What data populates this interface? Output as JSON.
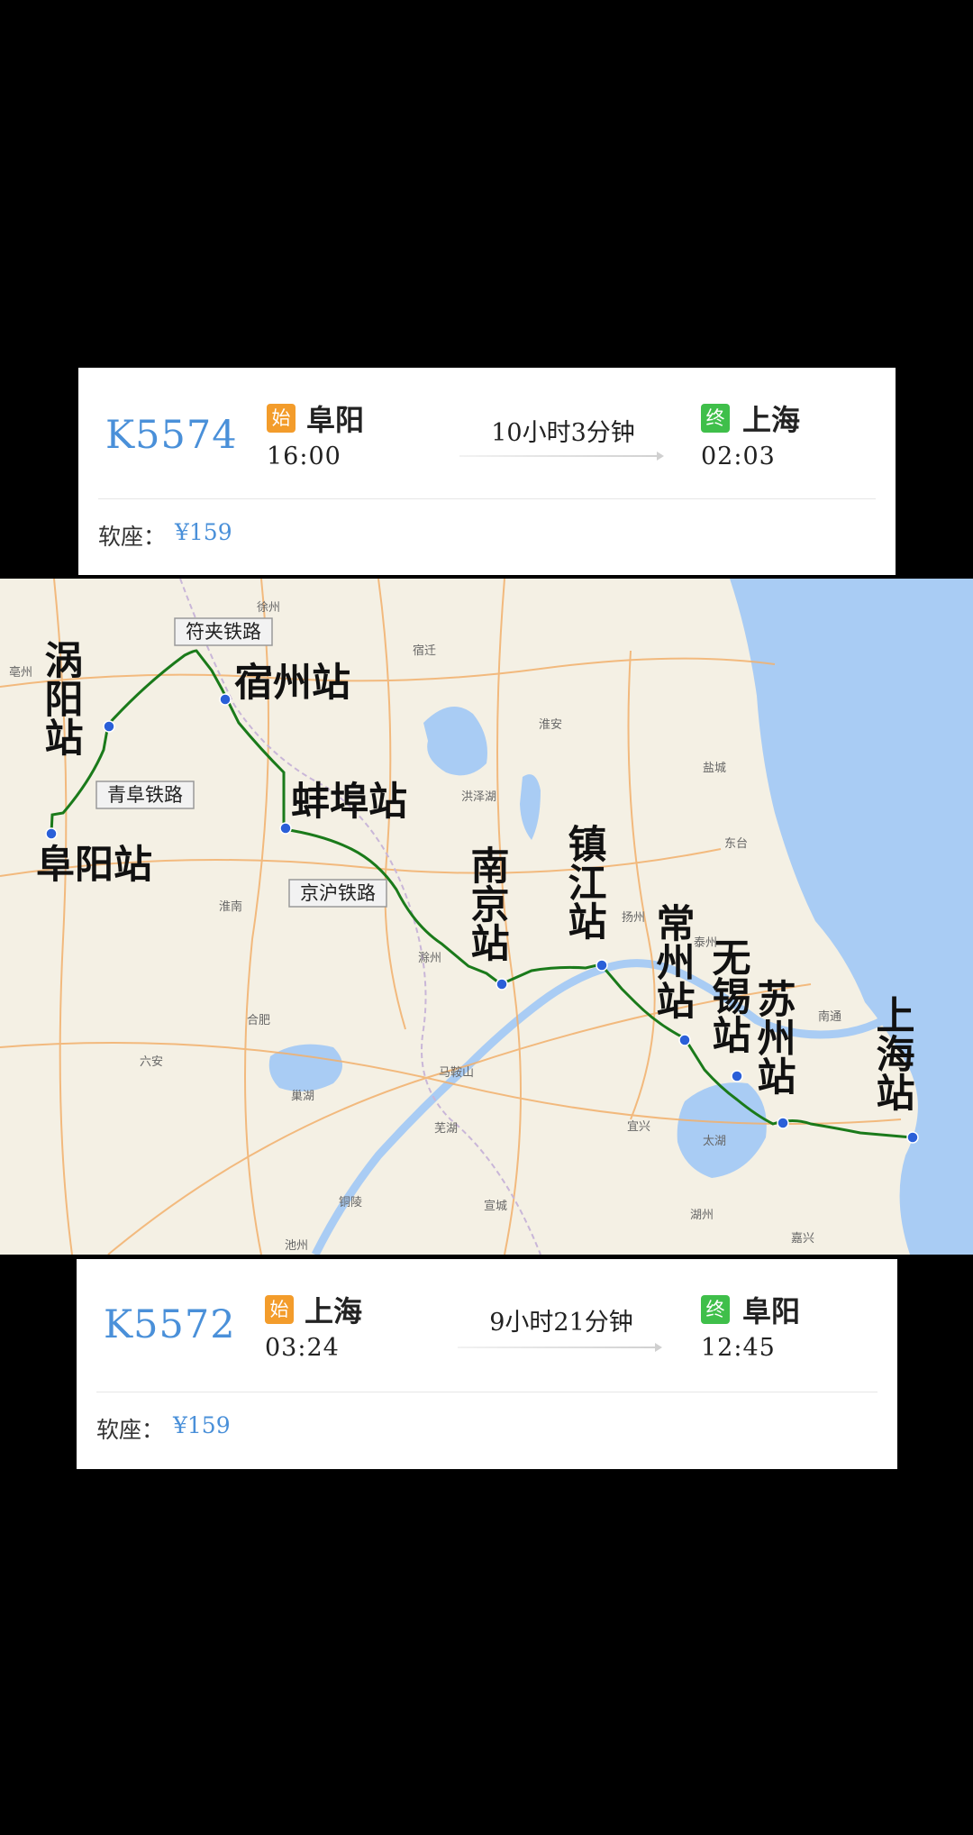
{
  "trains": [
    {
      "number": "K5574",
      "start_badge": "始",
      "from": "阜阳",
      "depart": "16:00",
      "duration": "10小时3分钟",
      "end_badge": "终",
      "to": "上海",
      "arrive": "02:03",
      "seat_label": "软座：",
      "price": "¥159"
    },
    {
      "number": "K5572",
      "start_badge": "始",
      "from": "上海",
      "depart": "03:24",
      "duration": "9小时21分钟",
      "end_badge": "终",
      "to": "阜阳",
      "arrive": "12:45",
      "seat_label": "软座：",
      "price": "¥159"
    }
  ],
  "map": {
    "colors": {
      "land": "#f4f0e4",
      "water": "#a9ccf4",
      "route": "#1a7a1a",
      "station_dot": "#2a5fd8",
      "road": "#f2b06c",
      "boundary": "#c9b6d8"
    },
    "station_labels": {
      "guoyang": "涡阳站",
      "fuyang": "阜阳站",
      "suzhou_ah": "宿州站",
      "bengbu": "蚌埠站",
      "nanjing": "南京站",
      "zhenjiang": "镇江站",
      "changzhou": "常州站",
      "wuxi": "无锡站",
      "suzhou_js": "苏州站",
      "shanghai": "上海站"
    },
    "railway_labels": {
      "fujia": "符夹铁路",
      "qingfu": "青阜铁路",
      "jinghu": "京沪铁路"
    },
    "place_labels": {
      "xuzhou": "徐州",
      "suqian": "宿迁",
      "huai_an": "淮安",
      "yancheng": "盐城",
      "hefei": "合肥",
      "chuzhou": "滁州",
      "huainan": "淮南",
      "wuhu": "芜湖",
      "maanshan": "马鞍山",
      "xuancheng": "宣城",
      "huzhou": "湖州",
      "jiaxing": "嘉兴",
      "nantong": "南通",
      "taizhou": "泰州",
      "yangzhou": "扬州",
      "bozhou": "亳州",
      "liuan": "六安",
      "chaohu": "巢湖",
      "hongzehu": "洪泽湖",
      "taihu": "太湖",
      "tongling": "铜陵",
      "chizhou": "池州",
      "yixing": "宜兴",
      "dongtai": "东台"
    }
  }
}
